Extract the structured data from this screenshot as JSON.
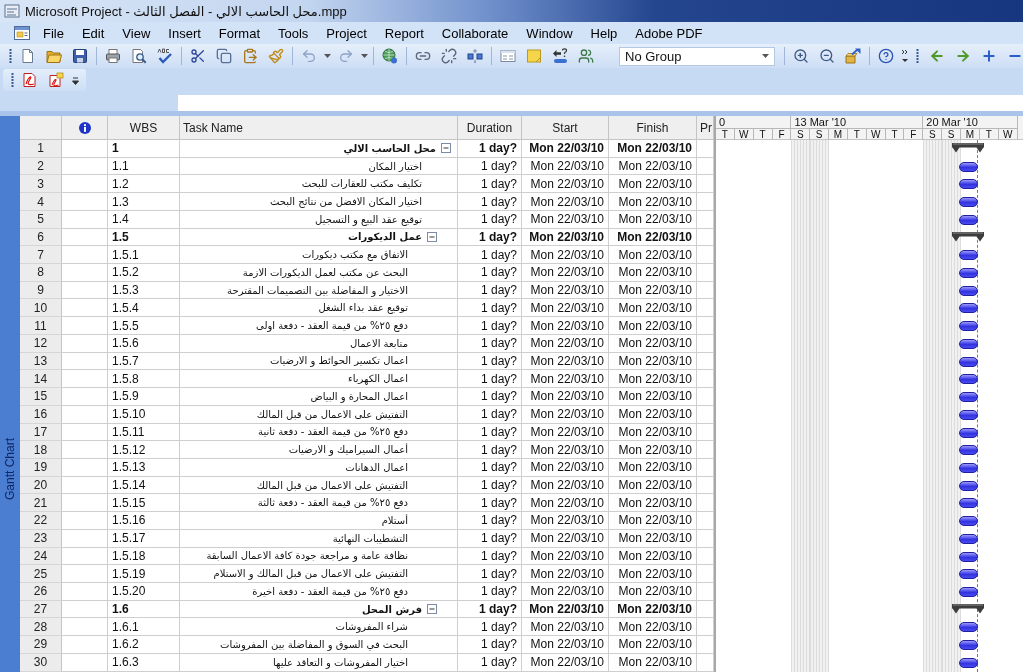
{
  "window": {
    "title": "Microsoft Project - محل الحاسب الالي - الفصل الثالث.mpp"
  },
  "menu": [
    {
      "label": "File"
    },
    {
      "label": "Edit"
    },
    {
      "label": "View"
    },
    {
      "label": "Insert"
    },
    {
      "label": "Format"
    },
    {
      "label": "Tools"
    },
    {
      "label": "Project"
    },
    {
      "label": "Report"
    },
    {
      "label": "Collaborate"
    },
    {
      "label": "Window"
    },
    {
      "label": "Help"
    },
    {
      "label": "Adobe PDF"
    }
  ],
  "toolbar": {
    "group_select": {
      "value": "No Group"
    }
  },
  "view_bar": {
    "label": "Gantt Chart"
  },
  "table": {
    "columns": [
      {
        "label": "WBS"
      },
      {
        "label": "Task Name"
      },
      {
        "label": "Duration"
      },
      {
        "label": "Start"
      },
      {
        "label": "Finish"
      },
      {
        "label": "Pr"
      }
    ]
  },
  "tasks": [
    {
      "id": "1",
      "wbs": "1",
      "name": "محل الحاسب الالي",
      "duration": "1 day?",
      "start": "Mon 22/03/10",
      "finish": "Mon 22/03/10",
      "expanded": true,
      "children": [
        {
          "id": "2",
          "wbs": "1.1",
          "name": "اختيار المكان",
          "duration": "1 day?",
          "start": "Mon 22/03/10",
          "finish": "Mon 22/03/10"
        },
        {
          "id": "3",
          "wbs": "1.2",
          "name": "تكليف مكتب للعقارات للبحث",
          "duration": "1 day?",
          "start": "Mon 22/03/10",
          "finish": "Mon 22/03/10"
        },
        {
          "id": "4",
          "wbs": "1.3",
          "name": "اختيار المكان الافضل من نتائج البحث",
          "duration": "1 day?",
          "start": "Mon 22/03/10",
          "finish": "Mon 22/03/10"
        },
        {
          "id": "5",
          "wbs": "1.4",
          "name": "توقيع عقد البيع و التسجيل",
          "duration": "1 day?",
          "start": "Mon 22/03/10",
          "finish": "Mon 22/03/10"
        },
        {
          "id": "6",
          "wbs": "1.5",
          "name": "عمل الديكورات",
          "duration": "1 day?",
          "start": "Mon 22/03/10",
          "finish": "Mon 22/03/10",
          "expanded": true,
          "children": [
            {
              "id": "7",
              "wbs": "1.5.1",
              "name": "الاتفاق مع مكتب ديكورات",
              "duration": "1 day?",
              "start": "Mon 22/03/10",
              "finish": "Mon 22/03/10"
            },
            {
              "id": "8",
              "wbs": "1.5.2",
              "name": "البحث عن مكتب لعمل الديكورات الازمة",
              "duration": "1 day?",
              "start": "Mon 22/03/10",
              "finish": "Mon 22/03/10"
            },
            {
              "id": "9",
              "wbs": "1.5.3",
              "name": "الاختيار و المفاضلة بين التصميمات المقترحة",
              "duration": "1 day?",
              "start": "Mon 22/03/10",
              "finish": "Mon 22/03/10"
            },
            {
              "id": "10",
              "wbs": "1.5.4",
              "name": "توقيع عقد بداء الشغل",
              "duration": "1 day?",
              "start": "Mon 22/03/10",
              "finish": "Mon 22/03/10"
            },
            {
              "id": "11",
              "wbs": "1.5.5",
              "name": "دفع ٢٥% من قيمة العقد - دفعة اولى",
              "duration": "1 day?",
              "start": "Mon 22/03/10",
              "finish": "Mon 22/03/10"
            },
            {
              "id": "12",
              "wbs": "1.5.6",
              "name": "متابعة الاعمال",
              "duration": "1 day?",
              "start": "Mon 22/03/10",
              "finish": "Mon 22/03/10"
            },
            {
              "id": "13",
              "wbs": "1.5.7",
              "name": "اعمال تكسير الحوائط و الارضيات",
              "duration": "1 day?",
              "start": "Mon 22/03/10",
              "finish": "Mon 22/03/10"
            },
            {
              "id": "14",
              "wbs": "1.5.8",
              "name": "اعمال الكهرباء",
              "duration": "1 day?",
              "start": "Mon 22/03/10",
              "finish": "Mon 22/03/10"
            },
            {
              "id": "15",
              "wbs": "1.5.9",
              "name": "اعمال المحارة و البياض",
              "duration": "1 day?",
              "start": "Mon 22/03/10",
              "finish": "Mon 22/03/10"
            },
            {
              "id": "16",
              "wbs": "1.5.10",
              "name": "التفتيش على الاعمال من قبل المالك",
              "duration": "1 day?",
              "start": "Mon 22/03/10",
              "finish": "Mon 22/03/10"
            },
            {
              "id": "17",
              "wbs": "1.5.11",
              "name": "دفع ٢٥% من قيمة العقد - دفعة ثانية",
              "duration": "1 day?",
              "start": "Mon 22/03/10",
              "finish": "Mon 22/03/10"
            },
            {
              "id": "18",
              "wbs": "1.5.12",
              "name": "أعمال السيراميك و الارضيات",
              "duration": "1 day?",
              "start": "Mon 22/03/10",
              "finish": "Mon 22/03/10"
            },
            {
              "id": "19",
              "wbs": "1.5.13",
              "name": "اعمال الدهانات",
              "duration": "1 day?",
              "start": "Mon 22/03/10",
              "finish": "Mon 22/03/10"
            },
            {
              "id": "20",
              "wbs": "1.5.14",
              "name": "التفتيش على الاعمال من قبل المالك",
              "duration": "1 day?",
              "start": "Mon 22/03/10",
              "finish": "Mon 22/03/10"
            },
            {
              "id": "21",
              "wbs": "1.5.15",
              "name": "دفع ٢٥% من قيمة العقد - دفعة ثالثة",
              "duration": "1 day?",
              "start": "Mon 22/03/10",
              "finish": "Mon 22/03/10"
            },
            {
              "id": "22",
              "wbs": "1.5.16",
              "name": "أستلام",
              "duration": "1 day?",
              "start": "Mon 22/03/10",
              "finish": "Mon 22/03/10"
            },
            {
              "id": "23",
              "wbs": "1.5.17",
              "name": "التشطيبات النهائية",
              "duration": "1 day?",
              "start": "Mon 22/03/10",
              "finish": "Mon 22/03/10"
            },
            {
              "id": "24",
              "wbs": "1.5.18",
              "name": "نظافة عامة و مراجعة جودة كافة الاعمال السابقة",
              "duration": "1 day?",
              "start": "Mon 22/03/10",
              "finish": "Mon 22/03/10"
            },
            {
              "id": "25",
              "wbs": "1.5.19",
              "name": "التفتيش على الاعمال من قبل المالك و الاستلام",
              "duration": "1 day?",
              "start": "Mon 22/03/10",
              "finish": "Mon 22/03/10"
            },
            {
              "id": "26",
              "wbs": "1.5.20",
              "name": "دفع ٢٥% من قيمة العقد - دفعة اخيرة",
              "duration": "1 day?",
              "start": "Mon 22/03/10",
              "finish": "Mon 22/03/10"
            }
          ]
        },
        {
          "id": "27",
          "wbs": "1.6",
          "name": "فرش المحل",
          "duration": "1 day?",
          "start": "Mon 22/03/10",
          "finish": "Mon 22/03/10",
          "expanded": true,
          "children": [
            {
              "id": "28",
              "wbs": "1.6.1",
              "name": "شراء المفروشات",
              "duration": "1 day?",
              "start": "Mon 22/03/10",
              "finish": "Mon 22/03/10"
            },
            {
              "id": "29",
              "wbs": "1.6.2",
              "name": "البحث في السوق و المفاضلة بين المفروشات",
              "duration": "1 day?",
              "start": "Mon 22/03/10",
              "finish": "Mon 22/03/10"
            },
            {
              "id": "30",
              "wbs": "1.6.3",
              "name": "اختيار المفروشات و التعاقد عليها",
              "duration": "1 day?",
              "start": "Mon 22/03/10",
              "finish": "Mon 22/03/10"
            }
          ]
        }
      ]
    }
  ],
  "gantt": {
    "weeks": [
      {
        "label": "0",
        "days": [
          {
            "label": "T",
            "nonworking": false
          },
          {
            "label": "W",
            "nonworking": false
          },
          {
            "label": "T",
            "nonworking": false
          },
          {
            "label": "F",
            "nonworking": false
          }
        ]
      },
      {
        "label": "13 Mar '10",
        "days": [
          {
            "label": "S",
            "nonworking": true
          },
          {
            "label": "S",
            "nonworking": true
          },
          {
            "label": "M",
            "nonworking": false
          },
          {
            "label": "T",
            "nonworking": false
          },
          {
            "label": "W",
            "nonworking": false
          },
          {
            "label": "T",
            "nonworking": false
          },
          {
            "label": "F",
            "nonworking": false
          }
        ]
      },
      {
        "label": "20 Mar '10",
        "days": [
          {
            "label": "S",
            "nonworking": true
          },
          {
            "label": "S",
            "nonworking": true
          },
          {
            "label": "M",
            "nonworking": false
          },
          {
            "label": "T",
            "nonworking": false
          },
          {
            "label": "W",
            "nonworking": false
          }
        ]
      }
    ]
  }
}
